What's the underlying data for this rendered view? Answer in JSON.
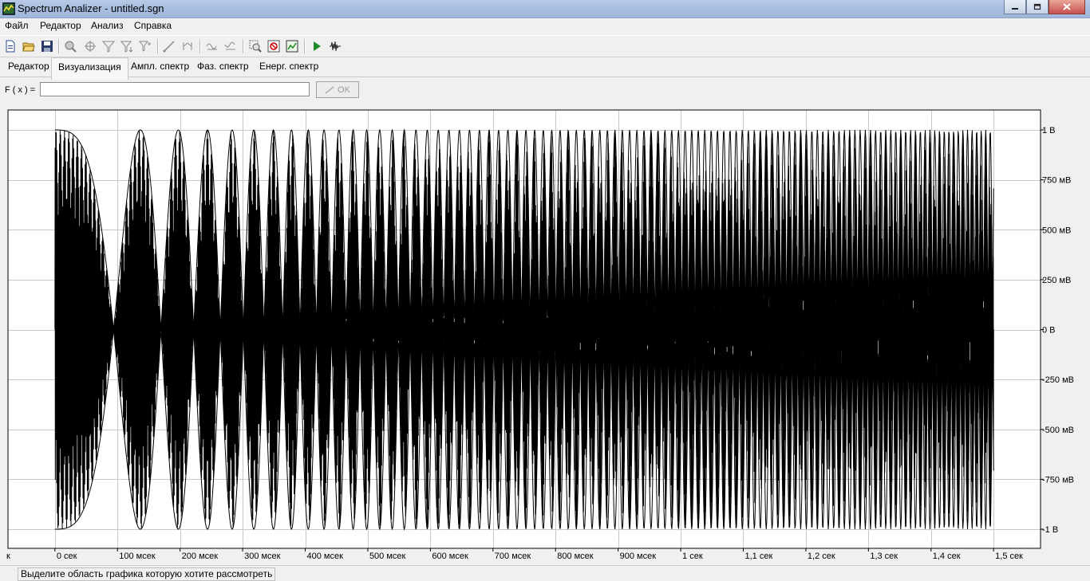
{
  "window": {
    "title": "Spectrum Analizer - untitled.sgn"
  },
  "menu": [
    {
      "label": "Файл"
    },
    {
      "label": "Редактор"
    },
    {
      "label": "Анализ"
    },
    {
      "label": "Справка"
    }
  ],
  "toolbar": {
    "icons": [
      "new-file-icon",
      "open-folder-icon",
      "save-icon",
      "zoom-icon",
      "crosshair-icon",
      "filter-icon",
      "filter-down-icon",
      "filter-multi-icon",
      "line-icon",
      "bracket-icon",
      "wave-edit-icon",
      "wave-edit-2-icon",
      "zoom-region-icon",
      "zoom-reset-icon",
      "chart-window-icon",
      "play-icon",
      "waveform-icon"
    ]
  },
  "tabs": [
    {
      "label": "Редактор",
      "active": false
    },
    {
      "label": "Визуализация",
      "active": true
    },
    {
      "label": "Ампл. спектр",
      "active": false
    },
    {
      "label": "Фаз. спектр",
      "active": false
    },
    {
      "label": "Енерг. спектр",
      "active": false
    }
  ],
  "formula": {
    "label": "F ( x ) =",
    "value": "",
    "ok_label": "OK"
  },
  "chart_data": {
    "type": "line",
    "description_signal": "chirp",
    "x_unit_label": "к",
    "xlim": [
      -0.075,
      1.575
    ],
    "ylim": [
      -1.1,
      1.0
    ],
    "x_ticks": [
      {
        "value": 0,
        "label": "0 сек"
      },
      {
        "value": 0.1,
        "label": "100 мсек"
      },
      {
        "value": 0.2,
        "label": "200 мсек"
      },
      {
        "value": 0.3,
        "label": "300 мсек"
      },
      {
        "value": 0.4,
        "label": "400 мсек"
      },
      {
        "value": 0.5,
        "label": "500 мсек"
      },
      {
        "value": 0.6,
        "label": "600 мсек"
      },
      {
        "value": 0.7,
        "label": "700 мсек"
      },
      {
        "value": 0.8,
        "label": "800 мсек"
      },
      {
        "value": 0.9,
        "label": "900 мсек"
      },
      {
        "value": 1.0,
        "label": "1 сек"
      },
      {
        "value": 1.1,
        "label": "1,1 сек"
      },
      {
        "value": 1.2,
        "label": "1,2 сек"
      },
      {
        "value": 1.3,
        "label": "1,3 сек"
      },
      {
        "value": 1.4,
        "label": "1,4 сек"
      },
      {
        "value": 1.5,
        "label": "1,5 сек"
      }
    ],
    "y_ticks": [
      {
        "value": 1,
        "label": "1 В"
      },
      {
        "value": 0.75,
        "label": "750 мВ"
      },
      {
        "value": 0.5,
        "label": "500 мВ"
      },
      {
        "value": 0.25,
        "label": "250 мВ"
      },
      {
        "value": 0,
        "label": "0 В"
      },
      {
        "value": -0.25,
        "label": "-250 мВ"
      },
      {
        "value": -0.5,
        "label": "-500 мВ"
      },
      {
        "value": -0.75,
        "label": "-750 мВ"
      },
      {
        "value": -1,
        "label": "-1 В"
      }
    ],
    "signal": {
      "t_start": 0,
      "t_end": 1.5,
      "amplitude": 1,
      "sample_rate": 200
    },
    "grid": true,
    "line_color": "#000000"
  },
  "status": {
    "text": "Выделите область графика которую хотите рассмотреть"
  }
}
